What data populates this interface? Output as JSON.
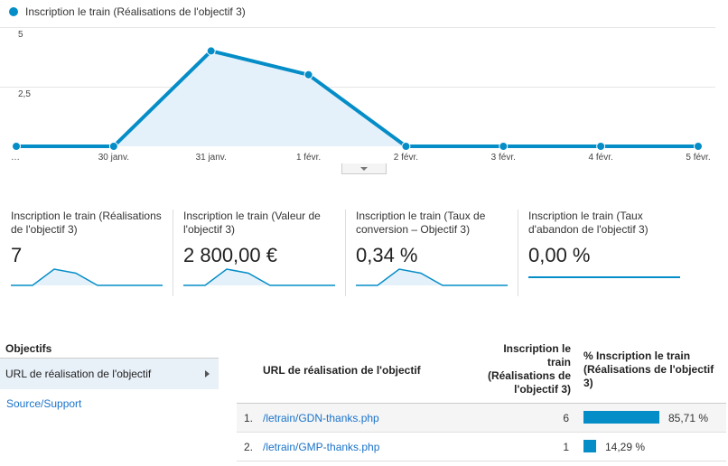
{
  "legend": {
    "label": "Inscription le train (Réalisations de l'objectif 3)",
    "color": "#058dc7"
  },
  "chart_data": {
    "type": "area",
    "series": [
      {
        "name": "Inscription le train (Réalisations de l'objectif 3)",
        "values": [
          0,
          0,
          4,
          3,
          0,
          0,
          0,
          0
        ]
      }
    ],
    "x": [
      "…",
      "30 janv.",
      "31 janv.",
      "1 févr.",
      "2 févr.",
      "3 févr.",
      "4 févr.",
      "5 févr."
    ],
    "y_ticks": [
      "5",
      "2,5"
    ],
    "ylim": [
      0,
      5
    ],
    "grid": true,
    "line_color": "#058dc7",
    "fill_color": "#e5f1fa"
  },
  "scorecards": [
    {
      "label": "Inscription le train (Réalisations de l'objectif 3)",
      "value": "7",
      "sparkline": [
        0,
        0,
        4,
        3,
        0,
        0,
        0,
        0
      ]
    },
    {
      "label": "Inscription le train (Valeur de l'objectif 3)",
      "value": "2 800,00 €",
      "sparkline": [
        0,
        0,
        4,
        3,
        0,
        0,
        0,
        0
      ]
    },
    {
      "label": "Inscription le train (Taux de conversion – Objectif 3)",
      "value": "0,34 %",
      "sparkline": [
        0,
        0,
        4,
        3,
        0,
        0,
        0,
        0
      ]
    },
    {
      "label": "Inscription le train (Taux d'abandon de l'objectif 3)",
      "value": "0,00 %",
      "sparkline": [
        0,
        0,
        0,
        0,
        0,
        0,
        0,
        0
      ]
    }
  ],
  "nav": {
    "title": "Objectifs",
    "selected": "URL de réalisation de l'objectif",
    "other": "Source/Support"
  },
  "table": {
    "headers": {
      "url": "URL de réalisation de l'objectif",
      "metric": "Inscription le train (Réalisations de l'objectif 3)",
      "pct": "% Inscription le train (Réalisations de l'objectif 3)"
    },
    "rows": [
      {
        "index": "1.",
        "url": "/letrain/GDN-thanks.php",
        "value": "6",
        "pct_label": "85,71 %",
        "pct": 85.71
      },
      {
        "index": "2.",
        "url": "/letrain/GMP-thanks.php",
        "value": "1",
        "pct_label": "14,29 %",
        "pct": 14.29
      }
    ]
  }
}
